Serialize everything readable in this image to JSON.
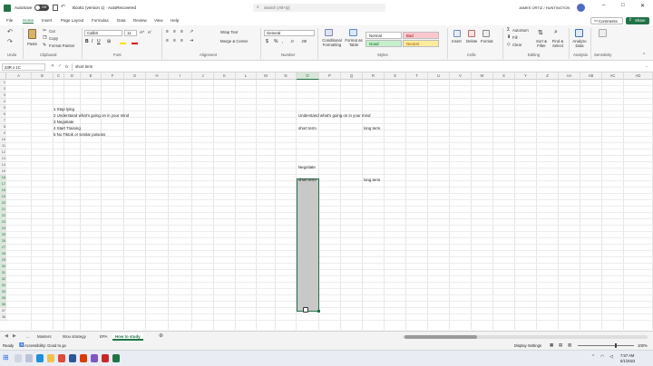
{
  "titlebar": {
    "autosave_label": "AutoSave",
    "autosave_state": "Off",
    "doc_title": "Book1 (version 1) · AutoRecovered",
    "search_placeholder": "Search (Alt+Q)",
    "user_name": "JAMES ORTIZ / HUNTINGTON"
  },
  "menu": {
    "items": [
      "File",
      "Home",
      "Insert",
      "Page Layout",
      "Formulas",
      "Data",
      "Review",
      "View",
      "Help"
    ],
    "comments": "Comments",
    "share": "Share"
  },
  "ribbon": {
    "undo": "Undo",
    "paste": "Paste",
    "cut": "Cut",
    "copy": "Copy",
    "format_painter": "Format Painter",
    "clipboard": "Clipboard",
    "font_name": "Calibri",
    "font_size": "11",
    "font": "Font",
    "wrap_text": "Wrap Text",
    "merge_center": "Merge & Center",
    "alignment": "Alignment",
    "number_format": "General",
    "number": "Number",
    "conditional_formatting": "Conditional Formatting",
    "format_as_table": "Format as Table",
    "styles": [
      "Normal",
      "Bad",
      "Good",
      "Neutral"
    ],
    "styles_label": "Styles",
    "insert": "Insert",
    "delete": "Delete",
    "format": "Format",
    "cells": "Cells",
    "autosum": "AutoSum",
    "fill": "Fill",
    "clear": "Clear",
    "sort_filter": "Sort & Filter",
    "find_select": "Find & Select",
    "editing": "Editing",
    "analyze_data": "Analyze Data",
    "analysis": "Analysis",
    "sensitivity": "Sensitivity"
  },
  "formula_bar": {
    "name_box": "23R x 1C",
    "fx": "fx",
    "content": "short term"
  },
  "grid": {
    "columns": [
      "A",
      "B",
      "C",
      "D",
      "E",
      "F",
      "G",
      "H",
      "I",
      "J",
      "K",
      "L",
      "M",
      "N",
      "O",
      "P",
      "Q",
      "R",
      "S",
      "T",
      "U",
      "V",
      "W",
      "X",
      "Y",
      "Z",
      "AA",
      "AB",
      "AC",
      "AD"
    ],
    "rows": [
      "1",
      "2",
      "3",
      "4",
      "5",
      "6",
      "7",
      "8",
      "9",
      "10",
      "11",
      "12",
      "13",
      "14",
      "15",
      "16",
      "17",
      "18",
      "19",
      "20",
      "21",
      "22",
      "23",
      "24",
      "25",
      "26",
      "27",
      "28",
      "29",
      "30",
      "31",
      "32",
      "33",
      "34",
      "35",
      "36",
      "37",
      "38"
    ],
    "list_items": [
      "1 Stop lying",
      "2 Understand what's going on in your mind",
      "3 Negotiate",
      "4 Start Training",
      "5 No Tiktok or similar poisons"
    ],
    "heading_understand": "Understand what's going on in your mind",
    "short_term_1": "short term",
    "long_term_1": "long term",
    "negotiate": "Negotiate",
    "short_term_2": "short term",
    "long_term_2": "long term"
  },
  "sheets": {
    "tabs": [
      "...",
      "Masters",
      "Wou strategy",
      "EPA",
      "How to study"
    ],
    "active": "How to study"
  },
  "status": {
    "ready": "Ready",
    "accessibility": "Accessibility: Good to go",
    "display_settings": "Display Settings",
    "zoom": "100%"
  },
  "taskbar": {
    "time": "7:57 AM",
    "date": "6/1/2022"
  },
  "colors": {
    "excel_green": "#217346",
    "selection": "#bfbfbf",
    "bad_fill": "#ffc7ce",
    "good_fill": "#c6efce",
    "neutral_fill": "#ffeb9c"
  }
}
